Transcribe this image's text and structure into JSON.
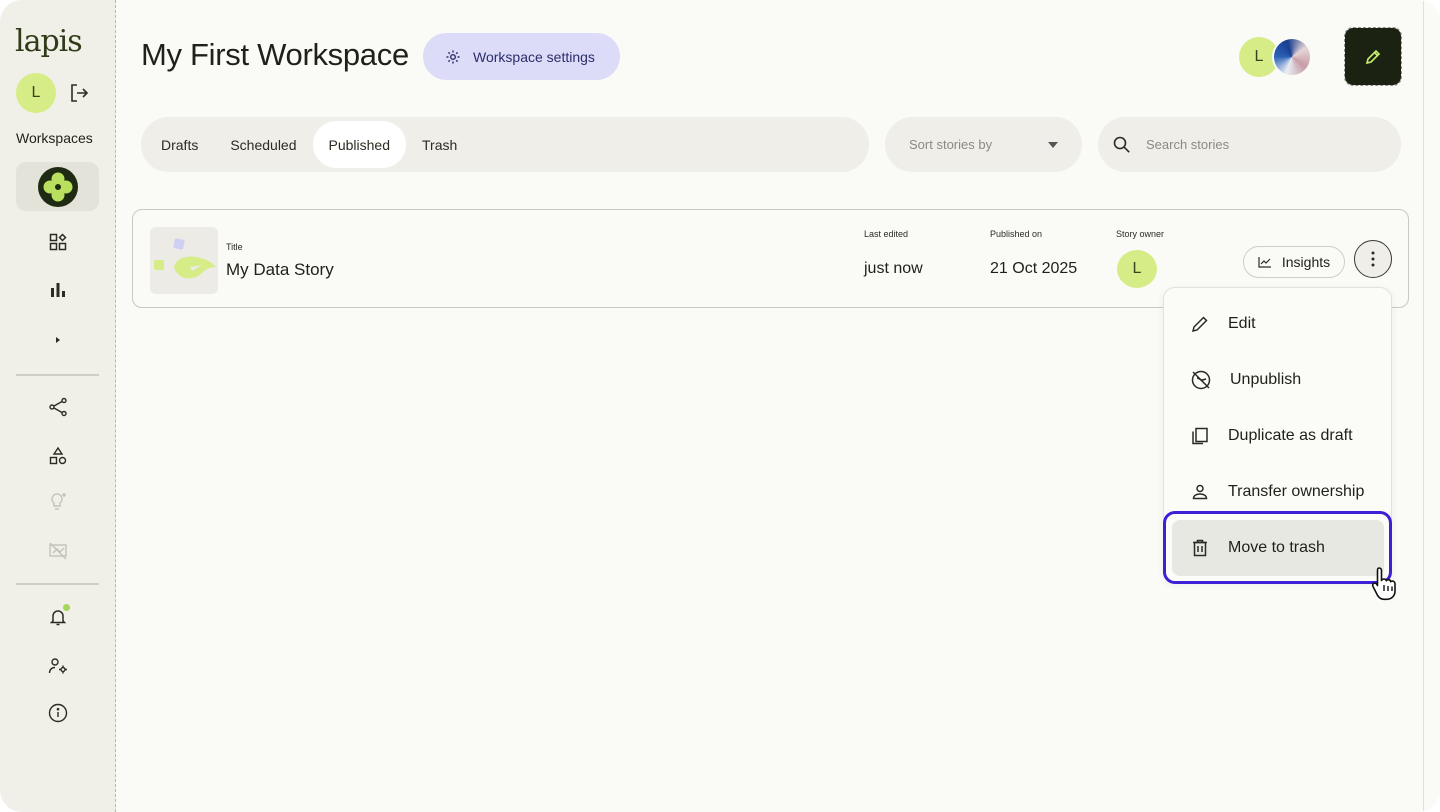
{
  "sidebar": {
    "logo": "lapis",
    "user_initial": "L",
    "workspaces_label": "Workspaces"
  },
  "header": {
    "title": "My First Workspace",
    "settings_label": "Workspace settings",
    "member_initial": "L"
  },
  "tabs": [
    {
      "label": "Drafts"
    },
    {
      "label": "Scheduled"
    },
    {
      "label": "Published",
      "active": true
    },
    {
      "label": "Trash"
    }
  ],
  "sort": {
    "placeholder": "Sort stories by"
  },
  "search": {
    "placeholder": "Search stories"
  },
  "story": {
    "title_label": "Title",
    "title": "My Data Story",
    "last_edited_label": "Last edited",
    "last_edited": "just now",
    "published_label": "Published on",
    "published": "21 Oct 2025",
    "owner_label": "Story owner",
    "owner_initial": "L",
    "insights_label": "Insights"
  },
  "menu": {
    "items": [
      {
        "label": "Edit",
        "icon": "pencil-icon"
      },
      {
        "label": "Unpublish",
        "icon": "unpublish-icon"
      },
      {
        "label": "Duplicate as draft",
        "icon": "duplicate-icon"
      },
      {
        "label": "Transfer ownership",
        "icon": "person-icon"
      },
      {
        "label": "Move to trash",
        "icon": "trash-icon",
        "hovered": true
      }
    ]
  },
  "colors": {
    "accent_green": "#d6ec86",
    "focus_ring": "#3d1fd6",
    "settings_bg": "#dcdcf8",
    "fab_bg": "#1c2212"
  }
}
